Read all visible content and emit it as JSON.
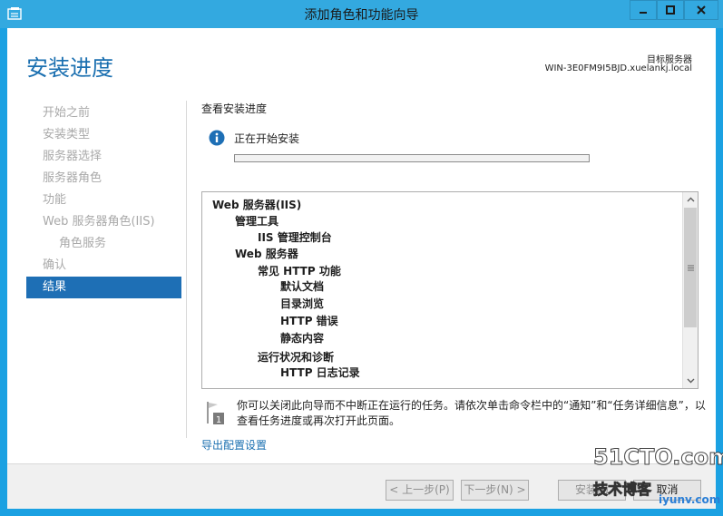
{
  "window": {
    "title": "添加角色和功能向导",
    "accent_color": "#1ba1e2"
  },
  "header": {
    "page_title": "安装进度",
    "server_label": "目标服务器",
    "server_name": "WIN-3E0FM9I5BJD.xuelankj.local"
  },
  "nav": {
    "items": [
      {
        "label": "开始之前",
        "state": "done"
      },
      {
        "label": "安装类型",
        "state": "done"
      },
      {
        "label": "服务器选择",
        "state": "done"
      },
      {
        "label": "服务器角色",
        "state": "done"
      },
      {
        "label": "功能",
        "state": "done"
      },
      {
        "label": "Web 服务器角色(IIS)",
        "state": "done"
      },
      {
        "label": "角色服务",
        "state": "done"
      },
      {
        "label": "确认",
        "state": "done"
      },
      {
        "label": "结果",
        "state": "active"
      }
    ]
  },
  "main": {
    "section_label": "查看安装进度",
    "status_icon": "info-icon",
    "status_text": "正在开始安装",
    "progress_percent": 0,
    "tree": [
      {
        "label": "Web 服务器(IIS)",
        "level": 0
      },
      {
        "label": "管理工具",
        "level": 1
      },
      {
        "label": "IIS 管理控制台",
        "level": 2
      },
      {
        "label": "Web 服务器",
        "level": 1
      },
      {
        "label": "常见 HTTP 功能",
        "level": 2
      },
      {
        "label": "默认文档",
        "level": 3
      },
      {
        "label": "目录浏览",
        "level": 3
      },
      {
        "label": "HTTP 错误",
        "level": 3
      },
      {
        "label": "静态内容",
        "level": 3
      },
      {
        "label": "运行状况和诊断",
        "level": 2
      },
      {
        "label": "HTTP 日志记录",
        "level": 3
      }
    ],
    "note_text": "你可以关闭此向导而不中断正在运行的任务。请依次单击命令栏中的“通知”和“任务详细信息”，以查看任务进度或再次打开此页面。",
    "export_link": "导出配置设置"
  },
  "footer": {
    "prev_label": "< 上一步(P)",
    "next_label": "下一步(N) >",
    "install_label": "安装(I)",
    "cancel_label": "取消"
  },
  "watermark": {
    "main": "51CTO.com",
    "sub": "技术博客",
    "site": "iyunv.com"
  }
}
